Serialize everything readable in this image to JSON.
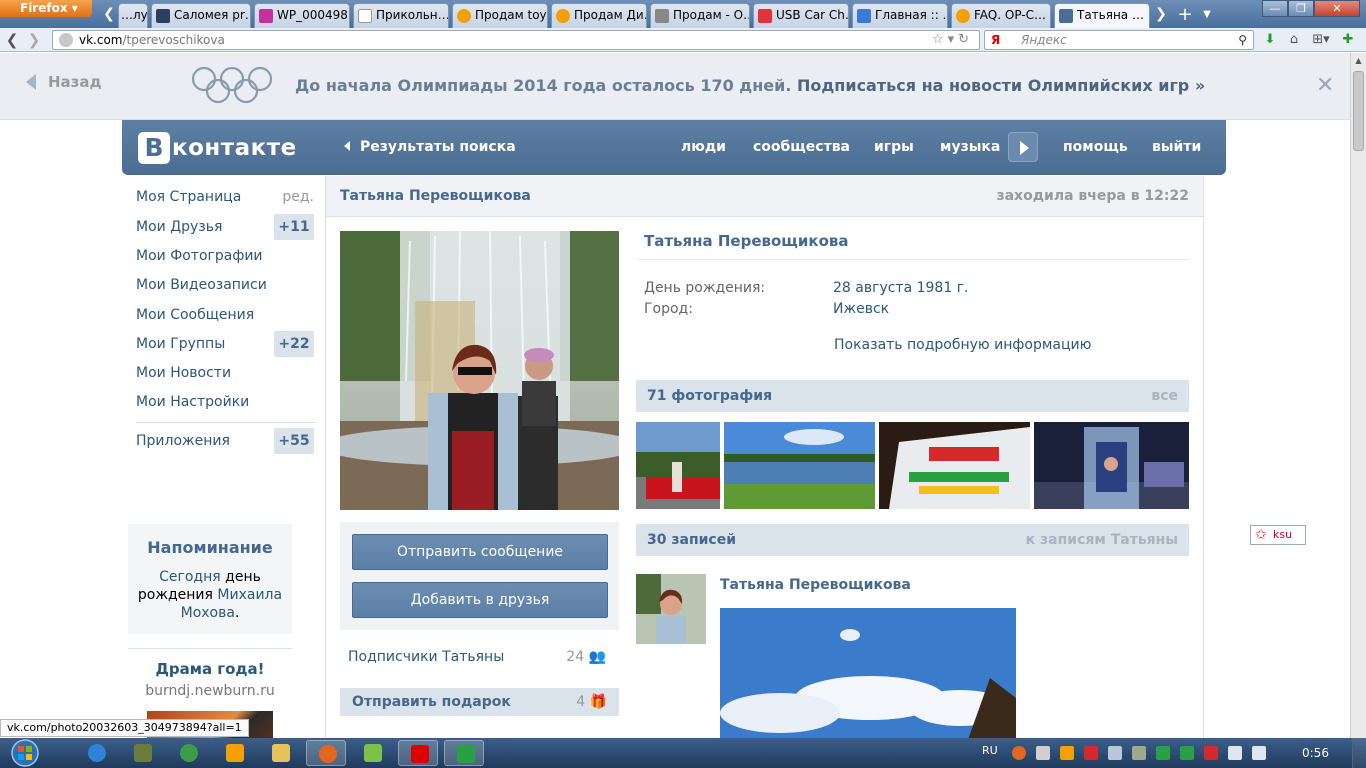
{
  "browser": {
    "app_button": "Firefox",
    "tabs": [
      {
        "label": "…лу…",
        "fav_color": "#4b6d93"
      },
      {
        "label": "Саломея pr…",
        "fav_color": "#2b3e63"
      },
      {
        "label": "WP_000498…",
        "fav_color": "#c4319d"
      },
      {
        "label": "Прикольн…",
        "fav_color": "#dddddd"
      },
      {
        "label": "Продам toy…",
        "fav_color": "#f2a100"
      },
      {
        "label": "Продам Ди…",
        "fav_color": "#f2a100"
      },
      {
        "label": "Продам - О…",
        "fav_color": "#888888"
      },
      {
        "label": "USB Car Ch…",
        "fav_color": "#e53238"
      },
      {
        "label": "Главная :: …",
        "fav_color": "#3a7bd5"
      },
      {
        "label": "FAQ. OP-C…",
        "fav_color": "#f2a100"
      },
      {
        "label": "Татьяна …",
        "fav_color": "#4b6d93"
      }
    ],
    "url_host": "vk.com",
    "url_path": "/tperevoschikova",
    "search_engine": "Я",
    "search_placeholder": "Яндекс"
  },
  "olympic_banner": {
    "back": "Назад",
    "text": "До начала Олимпиады 2014 года осталось 170 дней.",
    "subscribe": "Подписаться на новости Олимпийских игр »",
    "close": "✕"
  },
  "header": {
    "logo_letter": "В",
    "logo_word": "контакте",
    "breadcrumb": "Результаты поиска",
    "links": [
      "люди",
      "сообщества",
      "игры",
      "музыка",
      "помощь",
      "выйти"
    ]
  },
  "menu": {
    "items": [
      {
        "label": "Моя Страница",
        "badge": "",
        "edit": "ред."
      },
      {
        "label": "Мои Друзья",
        "badge": "+11",
        "edit": ""
      },
      {
        "label": "Мои Фотографии",
        "badge": "",
        "edit": ""
      },
      {
        "label": "Мои Видеозаписи",
        "badge": "",
        "edit": ""
      },
      {
        "label": "Мои Сообщения",
        "badge": "",
        "edit": ""
      },
      {
        "label": "Мои Группы",
        "badge": "+22",
        "edit": ""
      },
      {
        "label": "Мои Новости",
        "badge": "",
        "edit": ""
      },
      {
        "label": "Мои Настройки",
        "badge": "",
        "edit": ""
      }
    ],
    "apps": {
      "label": "Приложения",
      "badge": "+55"
    }
  },
  "reminder": {
    "title": "Напоминание",
    "today": "Сегодня",
    "middle": " день рождения ",
    "person": "Михаила Мохова",
    "end": "."
  },
  "ad": {
    "title": "Драма года!",
    "url": "burndj.newburn.ru"
  },
  "profile": {
    "name": "Татьяна Перевощикова",
    "last_seen": "заходила вчера в 12:22",
    "birthday_label": "День рождения:",
    "birthday_value": "28 августа 1981 г.",
    "city_label": "Город:",
    "city_value": "Ижевск",
    "more": "Показать подробную информацию",
    "send_message": "Отправить сообщение",
    "add_friend": "Добавить в друзья",
    "subscribers_label": "Подписчики Татьяны",
    "subscribers_count": "24",
    "gift_label": "Отправить подарок",
    "gift_count": "4"
  },
  "photos": {
    "title": "71 фотография",
    "all": "все"
  },
  "wall": {
    "title": "30 записей",
    "link": "к записям Татьяны",
    "post_author": "Татьяна Перевощикова"
  },
  "ksu_badge": "ksu",
  "status_url": "vk.com/photo20032603_304973894?all=1",
  "taskbar": {
    "lang": "RU",
    "clock": "0:56"
  }
}
